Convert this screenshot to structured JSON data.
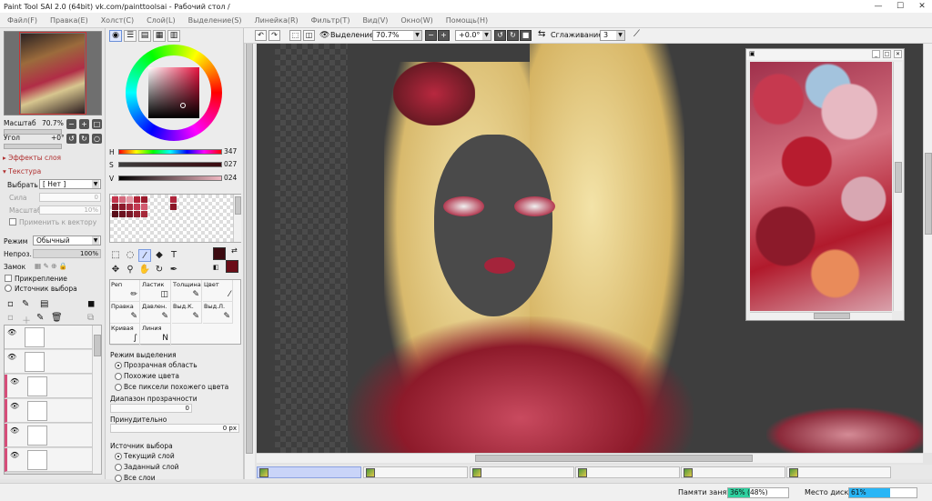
{
  "window": {
    "title": "Paint Tool SAI 2.0 (64bit) vk.com/painttoolsai - Рабочий стол /",
    "minimize": "—",
    "maximize": "☐",
    "close": "✕"
  },
  "menu": [
    "Файл(F)",
    "Правка(E)",
    "Холст(C)",
    "Слой(L)",
    "Выделение(S)",
    "Линейка(R)",
    "Фильтр(T)",
    "Вид(V)",
    "Окно(W)",
    "Помощь(H)"
  ],
  "navigator": {
    "scale_label": "Масштаб",
    "scale_value": "70.7%",
    "angle_label": "Угол",
    "angle_value": "+0°"
  },
  "layer_props": {
    "effects_label": "Эффекты слоя",
    "texture_label": "Текстура",
    "select_label": "Выбрать",
    "select_value": "[ Нет ]",
    "strength_label": "Сила",
    "strength_value": "0",
    "scale_label": "Масштаб",
    "scale_value": "10%",
    "apply_vector_label": "Применить к вектору",
    "mode_label": "Режим",
    "mode_value": "Обычный",
    "opacity_label": "Непроз.",
    "opacity_value": "100%",
    "lock_label": "Замок",
    "clip_label": "Прикрепление",
    "source_label": "Источник выбора"
  },
  "color": {
    "tabs": [
      "wheel-icon",
      "sliders-icon",
      "palette-icon",
      "swatch-icon",
      "mixer-icon"
    ],
    "h_label": "H",
    "h_value": "347",
    "s_label": "S",
    "s_value": "027",
    "v_label": "V",
    "v_value": "024",
    "foreground": "#3b0a10",
    "background": "#6b0d18"
  },
  "brushes": [
    {
      "label": "Реп",
      "icon": "✏"
    },
    {
      "label": "Ластик",
      "icon": "◫"
    },
    {
      "label": "Толщина",
      "icon": "✎"
    },
    {
      "label": "Цвет",
      "icon": "⁄"
    },
    {
      "label": "Правка",
      "icon": "✎"
    },
    {
      "label": "Давлен.",
      "icon": "✎"
    },
    {
      "label": "Выд.К.",
      "icon": "✎"
    },
    {
      "label": "Выд.Л.",
      "icon": "✎"
    },
    {
      "label": "Кривая",
      "icon": "∫"
    },
    {
      "label": "Линия",
      "icon": "N"
    }
  ],
  "selection_opts": {
    "mode_label": "Режим выделения",
    "mode_options": [
      "Прозрачная область",
      "Похожие цвета",
      "Все пиксели похожего цвета"
    ],
    "range_label": "Диапазон прозрачности",
    "range_value": "0",
    "force_label": "Принудительно",
    "force_value": "0 px",
    "source_label": "Источник выбора",
    "source_options": [
      "Текущий слой",
      "Заданный слой",
      "Все слои"
    ]
  },
  "toolbar": {
    "selection_label": "Выделение",
    "zoom_value": "70.7%",
    "angle_value": "+0.0°",
    "smoothing_label": "Сглаживание",
    "smoothing_value": "3"
  },
  "statusbar": {
    "memory_label": "Памяти занято",
    "memory_value": "36% (48%)",
    "memory_fill": 0.36,
    "disk_label": "Место диска",
    "disk_value": "61%",
    "disk_fill": 0.61
  },
  "doc_tabs_count": 6
}
